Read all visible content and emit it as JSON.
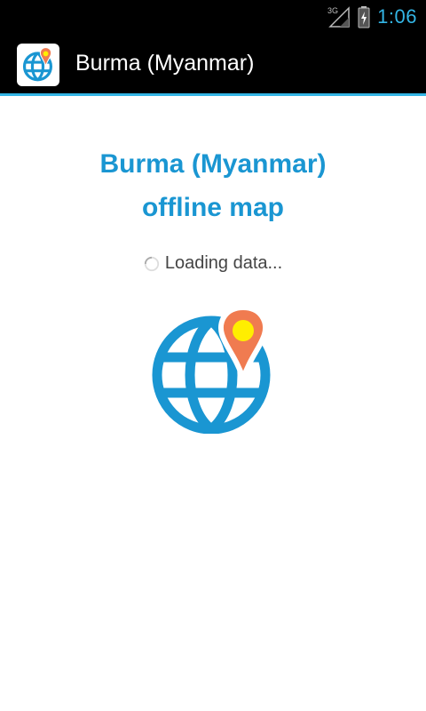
{
  "status_bar": {
    "network": "3G",
    "time": "1:06",
    "accent_color": "#33b5e5"
  },
  "action_bar": {
    "title": "Burma (Myanmar)",
    "icon": "globe-pin-icon"
  },
  "main": {
    "headline_line1": "Burma (Myanmar)",
    "headline_line2": "offline map",
    "loading_text": "Loading data...",
    "headline_color": "#1a96d2",
    "globe_color": "#1a96d2",
    "pin_color": "#f07b50",
    "pin_dot_color": "#ffee00"
  }
}
